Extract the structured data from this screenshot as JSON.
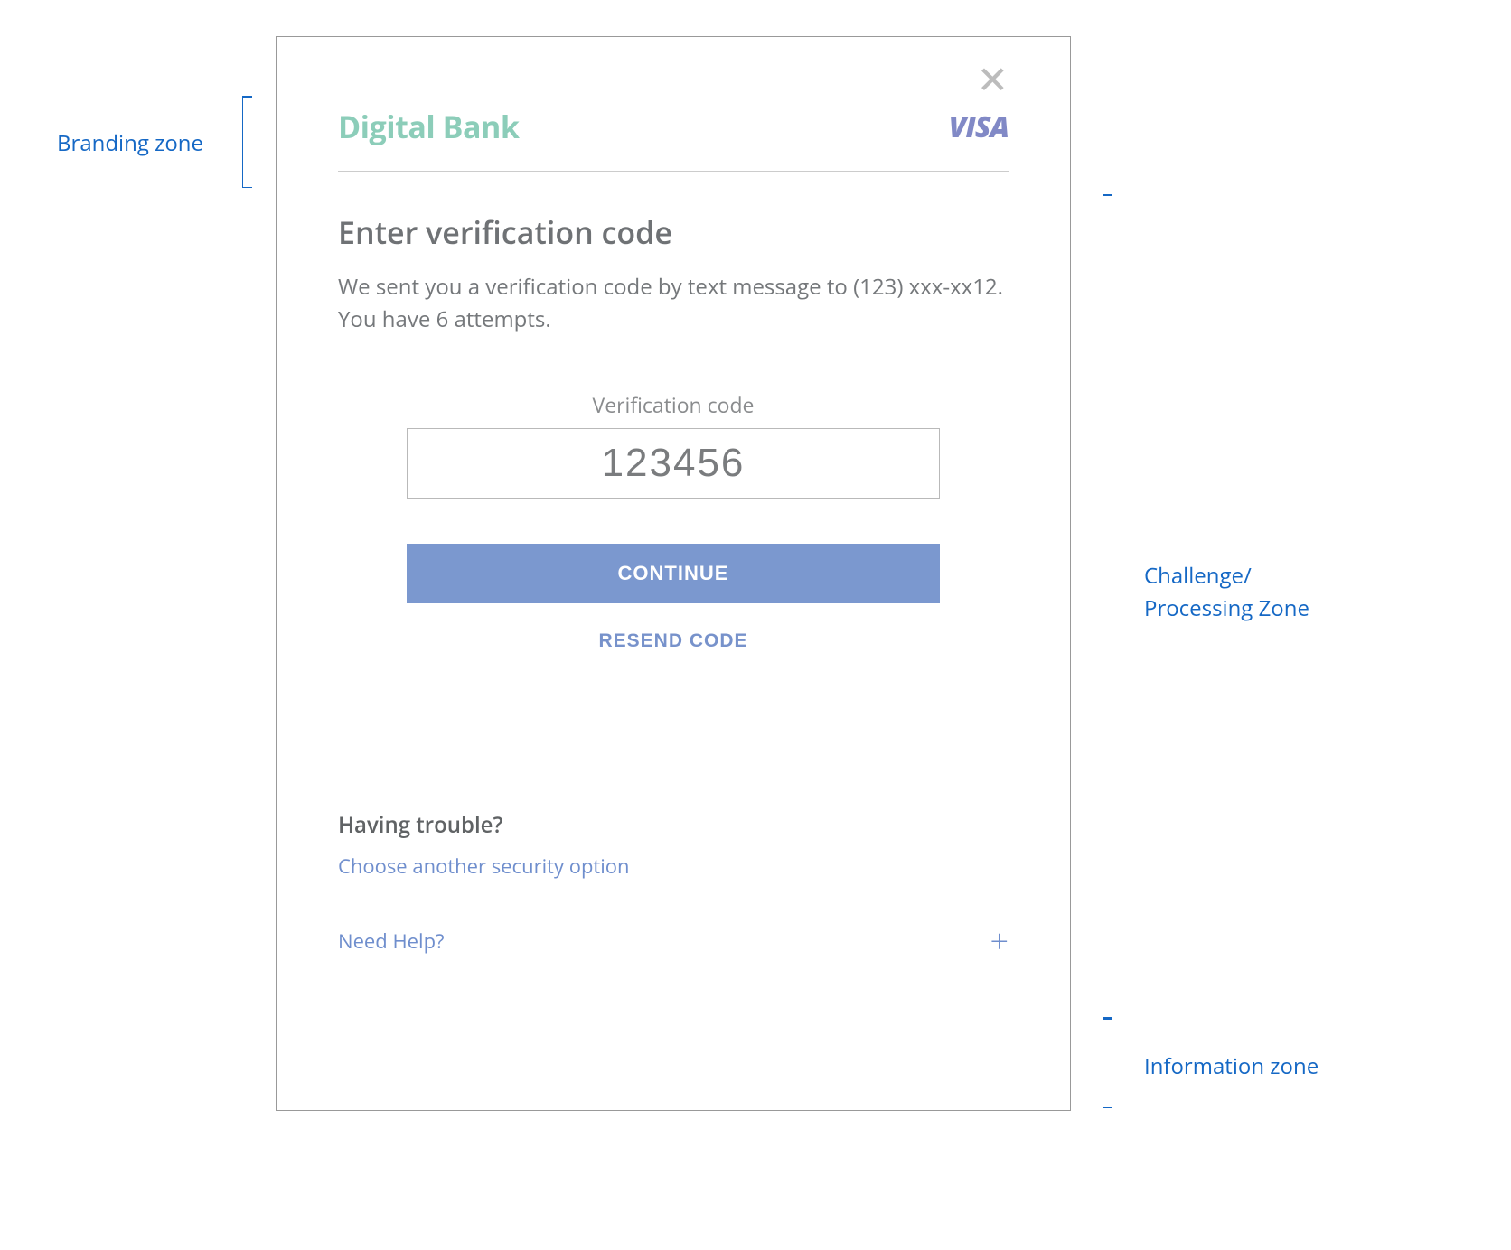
{
  "annotations": {
    "branding": "Branding zone",
    "challenge": "Challenge/\nProcessing Zone",
    "info": "Information zone"
  },
  "branding": {
    "bank_name": "Digital Bank",
    "card_network": "VISA"
  },
  "challenge": {
    "heading": "Enter verification code",
    "subtext": "We sent you a verification code by text message to (123) xxx-xx12. You have 6 attempts.",
    "input_label": "Verification code",
    "input_value": "123456",
    "continue_label": "CONTINUE",
    "resend_label": "RESEND CODE"
  },
  "trouble": {
    "heading": "Having trouble?",
    "link": "Choose another security option"
  },
  "help": {
    "label": "Need Help?"
  }
}
